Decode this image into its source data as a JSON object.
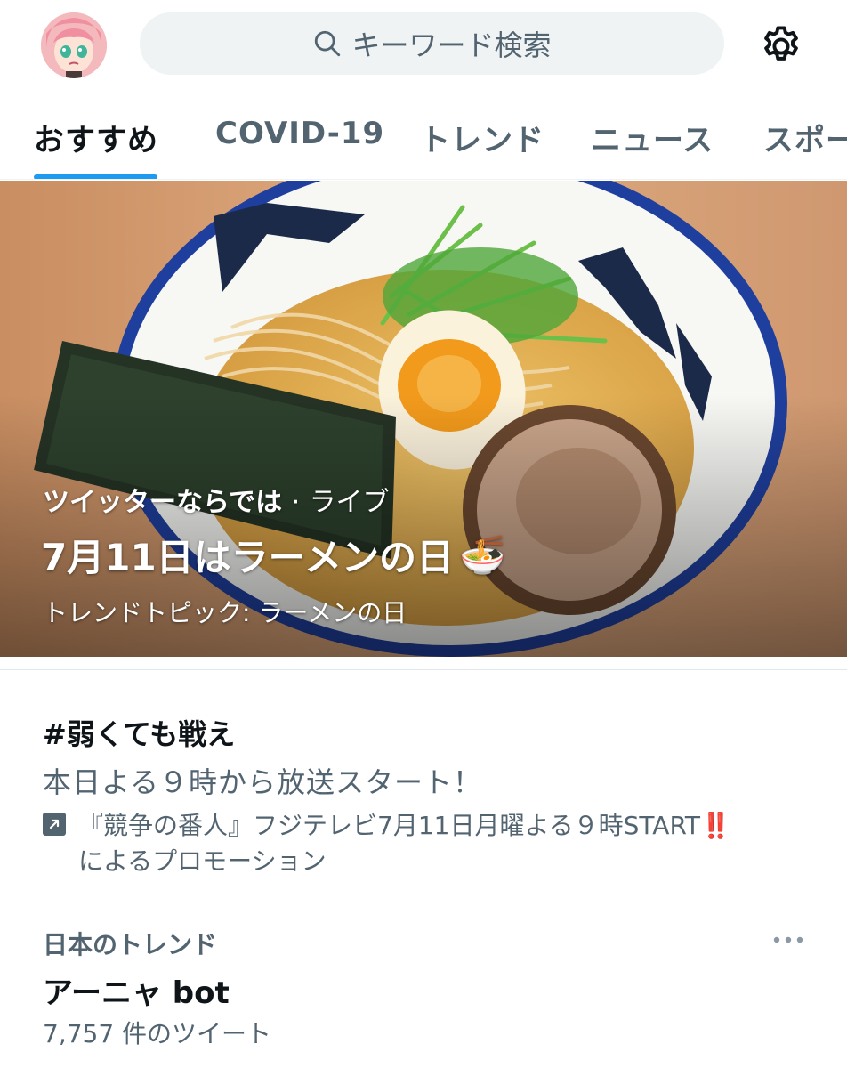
{
  "header": {
    "search_placeholder": "キーワード検索",
    "icons": {
      "search": "search-icon",
      "settings": "gear-icon",
      "avatar": "user-avatar"
    }
  },
  "tabs": [
    {
      "label": "おすすめ",
      "active": true
    },
    {
      "label": "COVID-19",
      "active": false
    },
    {
      "label": "トレンド",
      "active": false
    },
    {
      "label": "ニュース",
      "active": false
    },
    {
      "label": "スポー",
      "active": false
    }
  ],
  "hero": {
    "context": "ツイッターならでは",
    "separator": "·",
    "context_live": "ライブ",
    "title": "7月11日はラーメンの日",
    "emoji": "🍜",
    "subtitle": "トレンドトピック: ラーメンの日"
  },
  "promo": {
    "hashtag": "#弱くても戦え",
    "description": "本日よる９時から放送スタート！",
    "promoter": "『競争の番人』フジテレビ7月11日月曜よる９時START",
    "promoter_emoji": "‼️",
    "promoted_label": "によるプロモーション"
  },
  "trend": {
    "context": "日本のトレンド",
    "name": "アーニャ bot",
    "count": "7,757 件のツイート"
  },
  "colors": {
    "accent": "#1d9bf0",
    "secondary_text": "#536471",
    "primary_text": "#0f1419",
    "search_bg": "#eff3f4"
  }
}
